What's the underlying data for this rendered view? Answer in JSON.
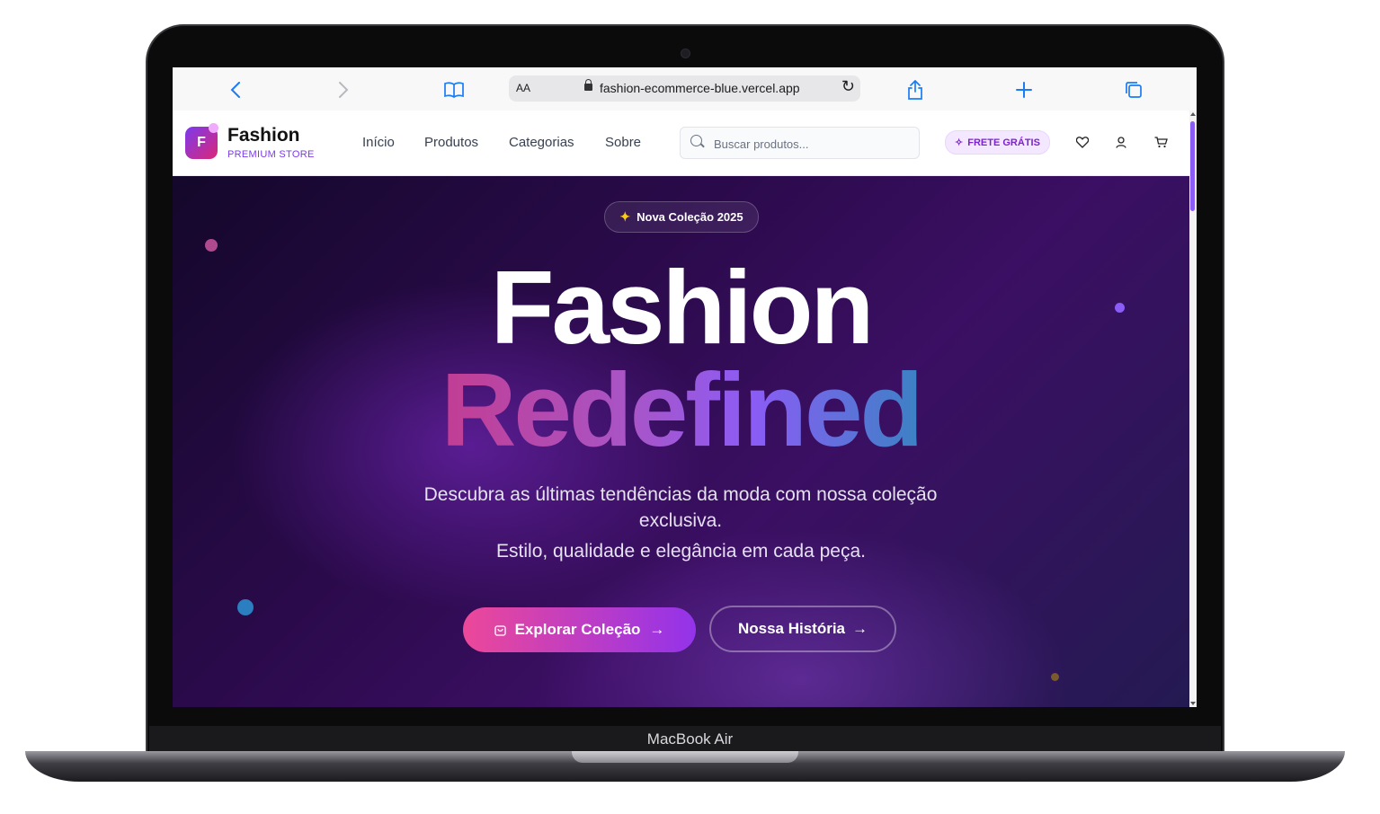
{
  "device": {
    "label": "MacBook Air"
  },
  "browser": {
    "text_size_label": "AA",
    "url": "fashion-ecommerce-blue.vercel.app",
    "icons": [
      "back-icon",
      "forward-icon",
      "bookmarks-icon",
      "lock-icon",
      "reload-icon",
      "share-icon",
      "new-tab-icon",
      "tabs-icon"
    ]
  },
  "header": {
    "logo_letter": "F",
    "brand_name": "Fashion",
    "brand_tagline": "PREMIUM STORE",
    "nav": [
      "Início",
      "Produtos",
      "Categorias",
      "Sobre"
    ],
    "search_placeholder": "Buscar produtos...",
    "badge": "FRETE GRÁTIS",
    "icons": [
      "heart-icon",
      "user-icon",
      "cart-icon"
    ]
  },
  "hero": {
    "pill": "Nova Coleção 2025",
    "title_line1": "Fashion",
    "title_line2": "Redefined",
    "subtitle1": "Descubra as últimas tendências da moda com nossa coleção exclusiva.",
    "subtitle2": "Estilo, qualidade e elegância em cada peça.",
    "primary_button": "Explorar Coleção",
    "secondary_button": "Nossa História"
  },
  "colors": {
    "accent": "#7c3aed",
    "primary_gradient_start": "#ec4899",
    "primary_gradient_end": "#9333ea",
    "hero_background": "#2a0a4a",
    "safari_blue": "#1a7cf5"
  }
}
